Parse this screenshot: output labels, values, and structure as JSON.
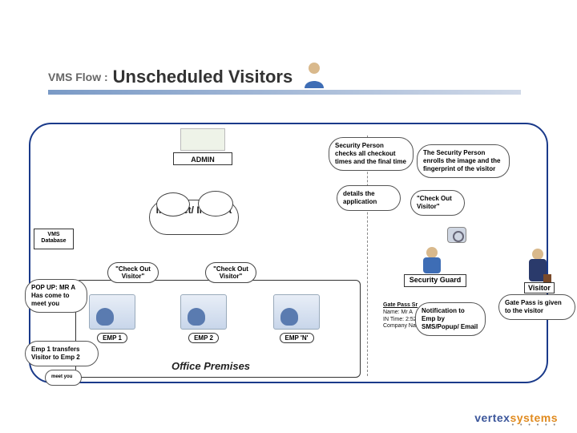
{
  "title": {
    "prefix": "VMS Flow :",
    "main": "Unscheduled Visitors"
  },
  "admin": {
    "label": "ADMIN"
  },
  "network": {
    "label": "Internet/ Intranet"
  },
  "db": {
    "label": "VMS Database"
  },
  "office": {
    "label": "Office Premises"
  },
  "emps": [
    {
      "label": "EMP 1"
    },
    {
      "label": "EMP 2"
    },
    {
      "label": "EMP 'N'"
    }
  ],
  "checkout_label": "\"Check Out Visitor\"",
  "popup": {
    "text": "POP UP: MR A Has come to meet you"
  },
  "transfer": {
    "text": "Emp 1 transfers Visitor to Emp 2"
  },
  "meet": {
    "text": "meet you"
  },
  "sec_check": {
    "text": "Security Person checks all checkout times and the final time"
  },
  "enroll": {
    "text": "The Security Person enrolls the image and the fingerprint of the visitor"
  },
  "details": {
    "text": "details the application"
  },
  "checkout_visitor": {
    "text": "\"Check Out Visitor\""
  },
  "sec_guard": {
    "label": "Security Guard"
  },
  "gate_pass": {
    "header": "Gate Pass Sr",
    "name": "Name: Mr A",
    "in_time": "IN Time: 2:52 PM",
    "company": "Company Name: XYZ"
  },
  "notification": {
    "text": "Notification to Emp by SMS/Popup/ Email"
  },
  "gatepass_given": {
    "text": "Gate Pass is given to the visitor"
  },
  "visitor": {
    "label": "Visitor"
  },
  "footer": {
    "brand": "vertex",
    "suffix": "systems"
  }
}
